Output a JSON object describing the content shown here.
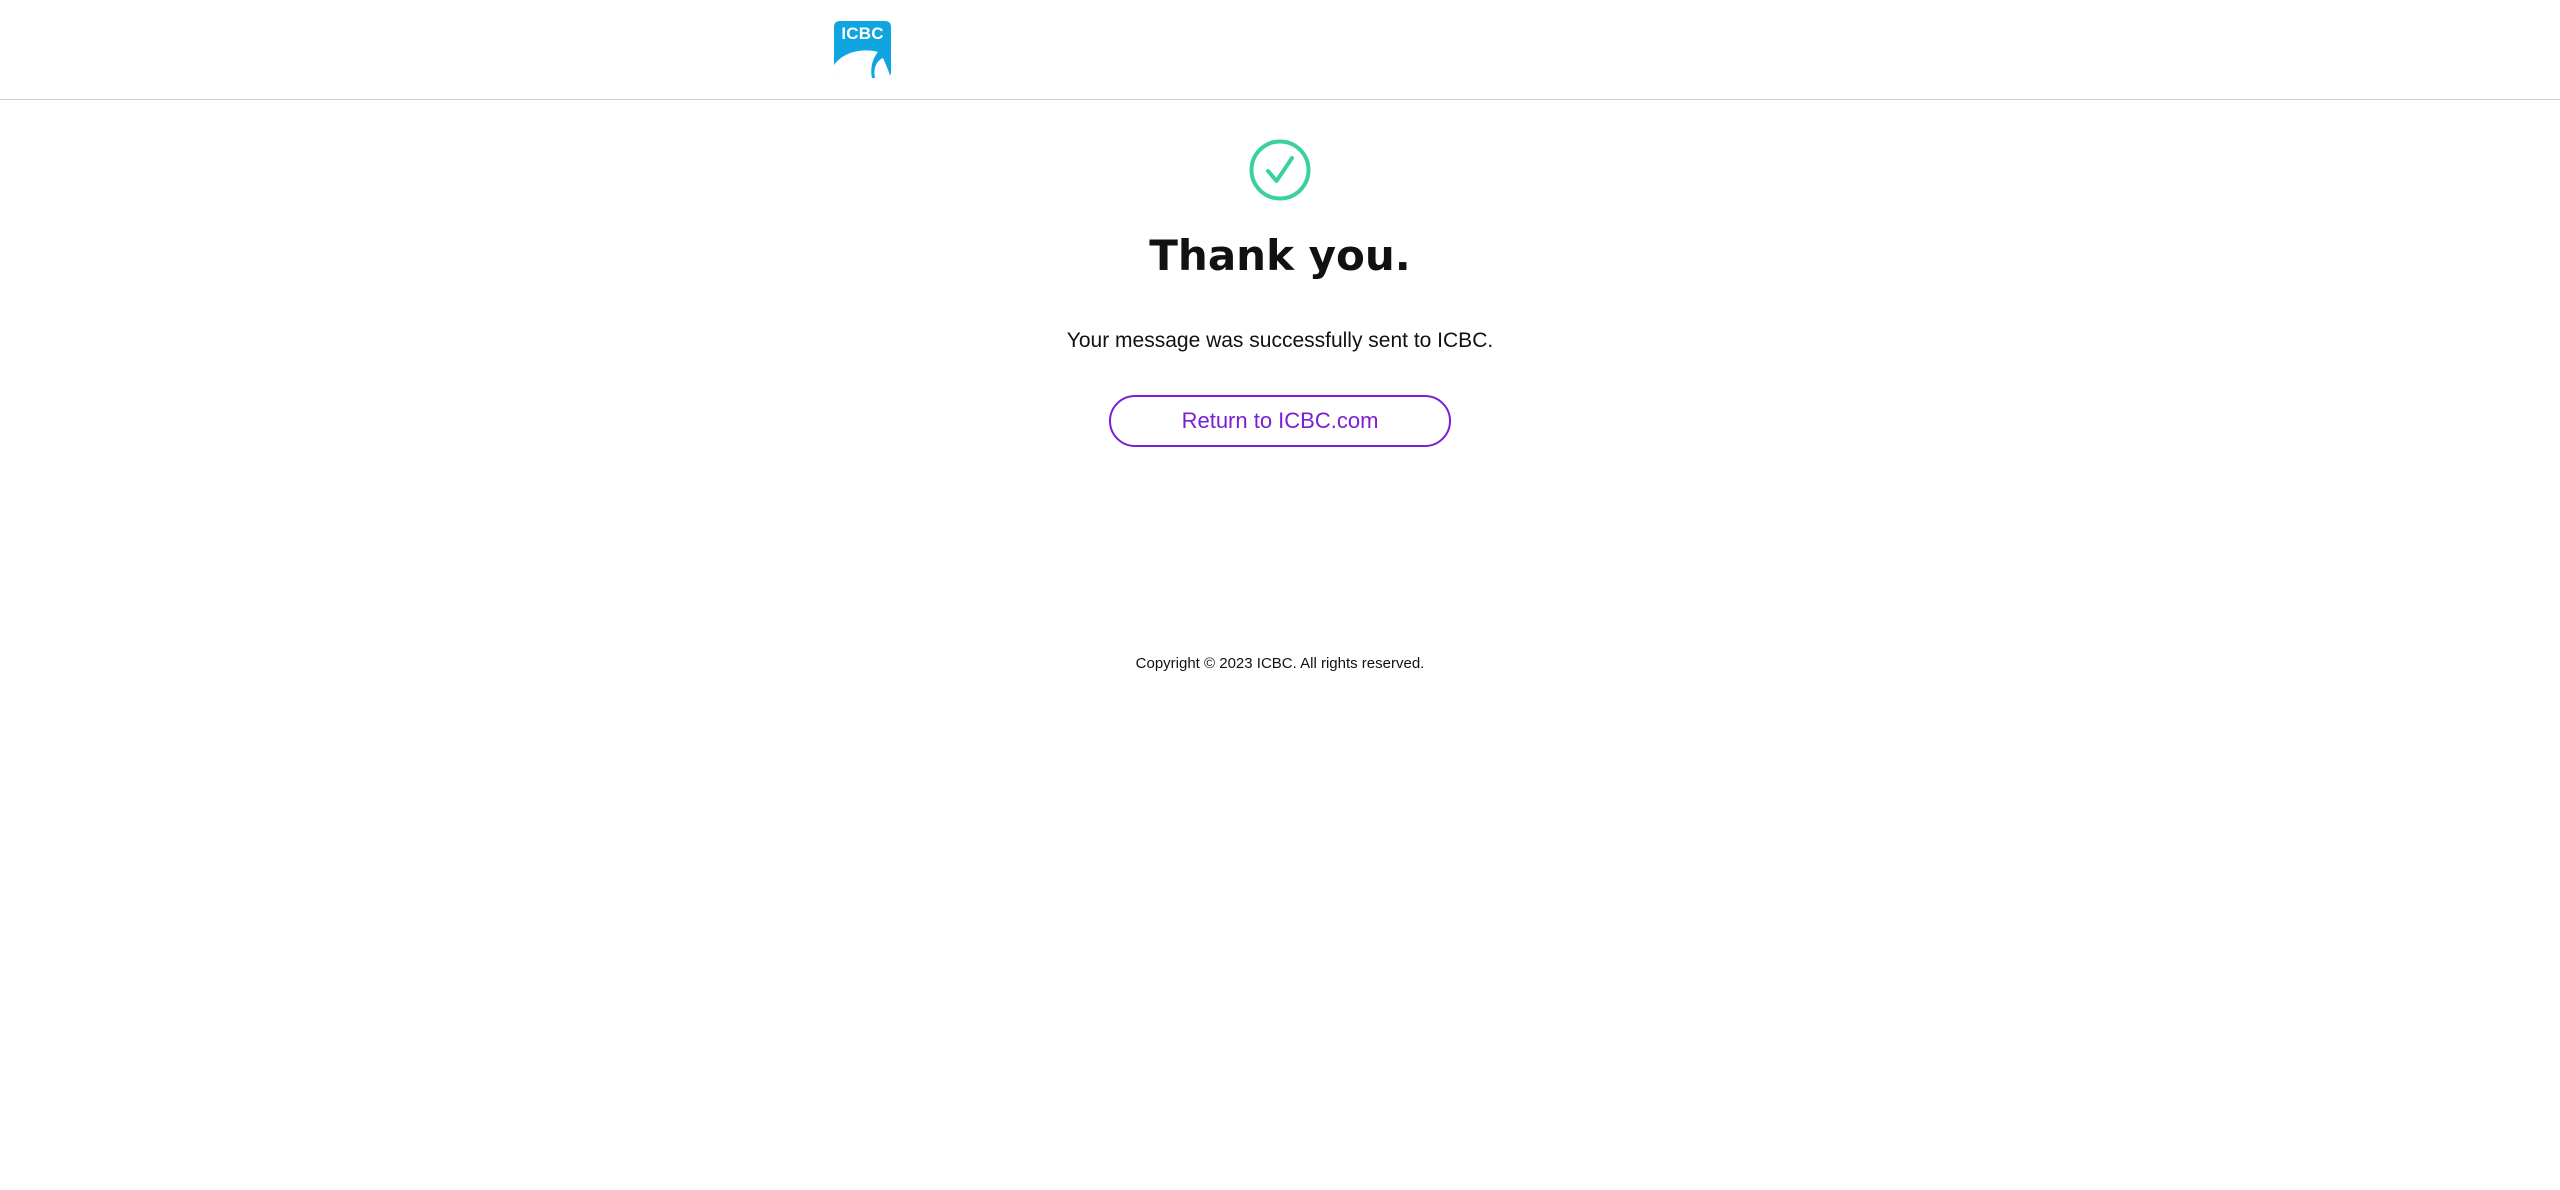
{
  "header": {
    "logo_text": "ICBC",
    "logo_icon": "icbc-logo-icon"
  },
  "main": {
    "success_icon": "check-circle-icon",
    "title": "Thank you.",
    "message": "Your message was successfully sent to ICBC.",
    "return_button_label": "Return to ICBC.com"
  },
  "footer": {
    "copyright": "Copyright © 2023 ICBC. All rights reserved."
  },
  "colors": {
    "brand_blue": "#0ea5e0",
    "success_green": "#3ad0a3",
    "accent_purple": "#7a1fd6"
  }
}
